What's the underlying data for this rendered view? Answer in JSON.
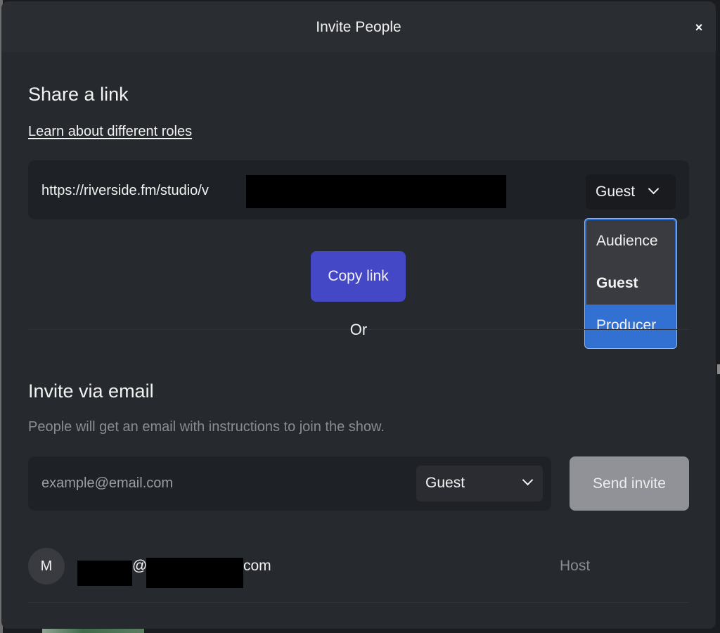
{
  "modal": {
    "title": "Invite People",
    "close_label": "×"
  },
  "share_link": {
    "title": "Share a link",
    "learn_link": "Learn about different roles",
    "url_visible": "https://riverside.fm/studio/v",
    "role_selected": "Guest",
    "role_options": [
      {
        "label": "Audience",
        "selected": false,
        "highlighted": false
      },
      {
        "label": "Guest",
        "selected": true,
        "highlighted": false
      },
      {
        "label": "Producer",
        "selected": false,
        "highlighted": true
      }
    ],
    "copy_button": "Copy link",
    "or_label": "Or"
  },
  "invite_email": {
    "title": "Invite via email",
    "subtitle": "People will get an email with instructions to join the show.",
    "email_value": "",
    "email_placeholder": "example@email.com",
    "role_selected": "Guest",
    "send_button": "Send invite"
  },
  "members": [
    {
      "avatar_initial": "M",
      "email_at": "@",
      "email_suffix": "com",
      "role": "Host"
    }
  ],
  "colors": {
    "primary_button": "#4448c6",
    "dropdown_highlight": "#3271d1",
    "disabled_button": "#919297",
    "modal_background": "#26292e"
  }
}
